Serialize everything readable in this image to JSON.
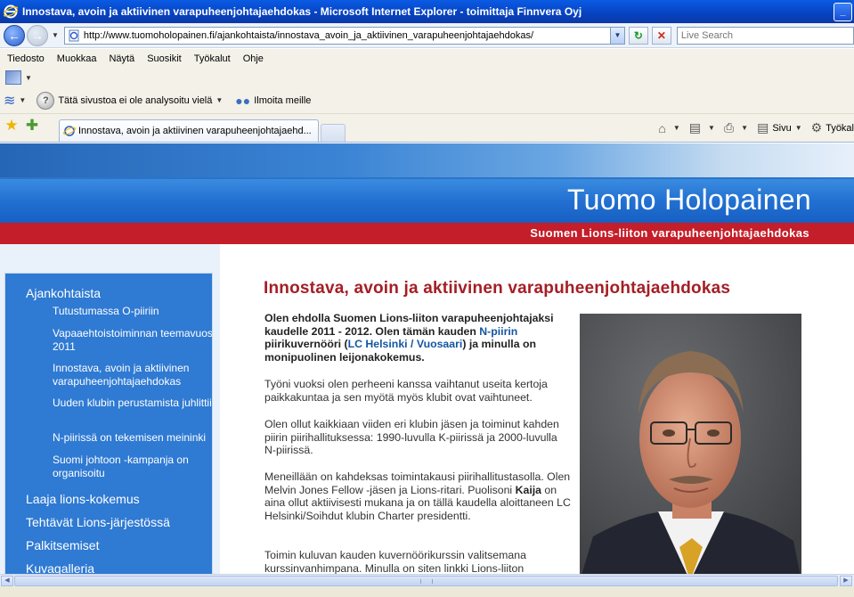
{
  "window": {
    "title": "Innostava, avoin ja aktiivinen varapuheenjohtajaehdokas - Microsoft Internet Explorer - toimittaja Finnvera Oyj",
    "minimize_glyph": "_"
  },
  "address_bar": {
    "url": "http://www.tuomoholopainen.fi/ajankohtaista/innostava_avoin_ja_aktiivinen_varapuheenjohtajaehdokas/",
    "search_placeholder": "Live Search"
  },
  "menu_bar": [
    "Tiedosto",
    "Muokkaa",
    "Näytä",
    "Suosikit",
    "Työkalut",
    "Ohje"
  ],
  "toolbar": {
    "site_analysis": "Tätä sivustoa ei ole analysoitu vielä",
    "report": "Ilmoita meille"
  },
  "tab": {
    "label": "Innostava, avoin ja aktiivinen varapuheenjohtajaehd..."
  },
  "commands": {
    "page": "Sivu",
    "tools": "Työkal"
  },
  "page": {
    "site_name": "Tuomo Holopainen",
    "site_subtitle": "Suomen Lions-liiton varapuheenjohtajaehdokas",
    "heading": "Innostava, avoin ja aktiivinen varapuheenjohtajaehdokas",
    "nav": {
      "ajankohtaista": "Ajankohtaista",
      "sub": [
        "Tutustumassa O-piiriin",
        "Vapaaehtoistoiminnan teemavuosi 2011",
        "Innostava, avoin ja aktiivinen varapuheenjohtajaehdokas",
        "Uuden klubin perustamista juhlittiin",
        "N-piirissä on tekemisen meininki",
        "Suomi johtoon -kampanja on organisoitu"
      ],
      "laaja": "Laaja lions-kokemus",
      "tehtavat": "Tehtävät Lions-järjestössä",
      "palkitsemiset": "Palkitsemiset",
      "kuvagalleria": "Kuvagalleria"
    },
    "intro_pre": "Olen ehdolla Suomen Lions-liiton varapuheenjohtajaksi kaudelle 2011 - 2012. Olen tämän kauden ",
    "intro_link1": "N-piirin",
    "intro_mid": " piirikuvernööri (",
    "intro_link2": "LC Helsinki / Vuosaari",
    "intro_post": ") ja minulla on monipuolinen leijonakokemus.",
    "p1": "Työni vuoksi olen perheeni kanssa  vaihtanut useita kertoja paikkakuntaa ja sen myötä myös klubit ovat vaihtuneet.",
    "p2": "Olen ollut kaikkiaan viiden eri klubin jäsen ja toiminut kahden piirin piirihallituksessa: 1990-luvulla K-piirissä ja 2000-luvulla N-piirissä.",
    "p3_pre": "Meneillään on kahdeksas toimintakausi piirihallitustasolla.  Olen Melvin Jones Fellow -jäsen ja Lions-ritari.  Puolisoni ",
    "p3_bold": "Kaija",
    "p3_post": " on aina ollut aktiivisesti mukana ja on tällä kaudella aloittaneen LC Helsinki/Soihdut klubin Charter presidentti.",
    "p4": "Toimin kuluvan kauden kuvernöörikurssin valitsemana kurssinvanhimpana. Minulla on siten linkki Lions-liiton"
  }
}
